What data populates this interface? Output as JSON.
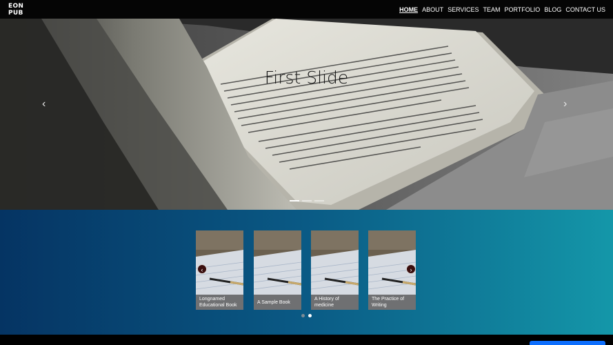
{
  "brand": {
    "line1": "EON",
    "line2": "PUB"
  },
  "nav": [
    {
      "label": "HOME",
      "active": true
    },
    {
      "label": "ABOUT"
    },
    {
      "label": "SERVICES"
    },
    {
      "label": "TEAM"
    },
    {
      "label": "PORTFOLIO"
    },
    {
      "label": "BLOG"
    },
    {
      "label": "CONTACT US"
    }
  ],
  "hero": {
    "title": "First Slide",
    "prev_icon": "‹",
    "next_icon": "›",
    "slide_count": 3,
    "active_slide": 1
  },
  "cards": {
    "items": [
      {
        "caption": "Longnamed Educational Book"
      },
      {
        "caption": "A Sample Book"
      },
      {
        "caption": "A History of medicine"
      },
      {
        "caption": "The Practice of Writing"
      }
    ],
    "prev_icon": "‹",
    "next_icon": "›",
    "page_count": 2,
    "active_page": 2
  },
  "colors": {
    "navbar": "#050505",
    "gradient_start": "#053463",
    "gradient_end": "#1497a9",
    "accent_button": "#0d6efd"
  }
}
